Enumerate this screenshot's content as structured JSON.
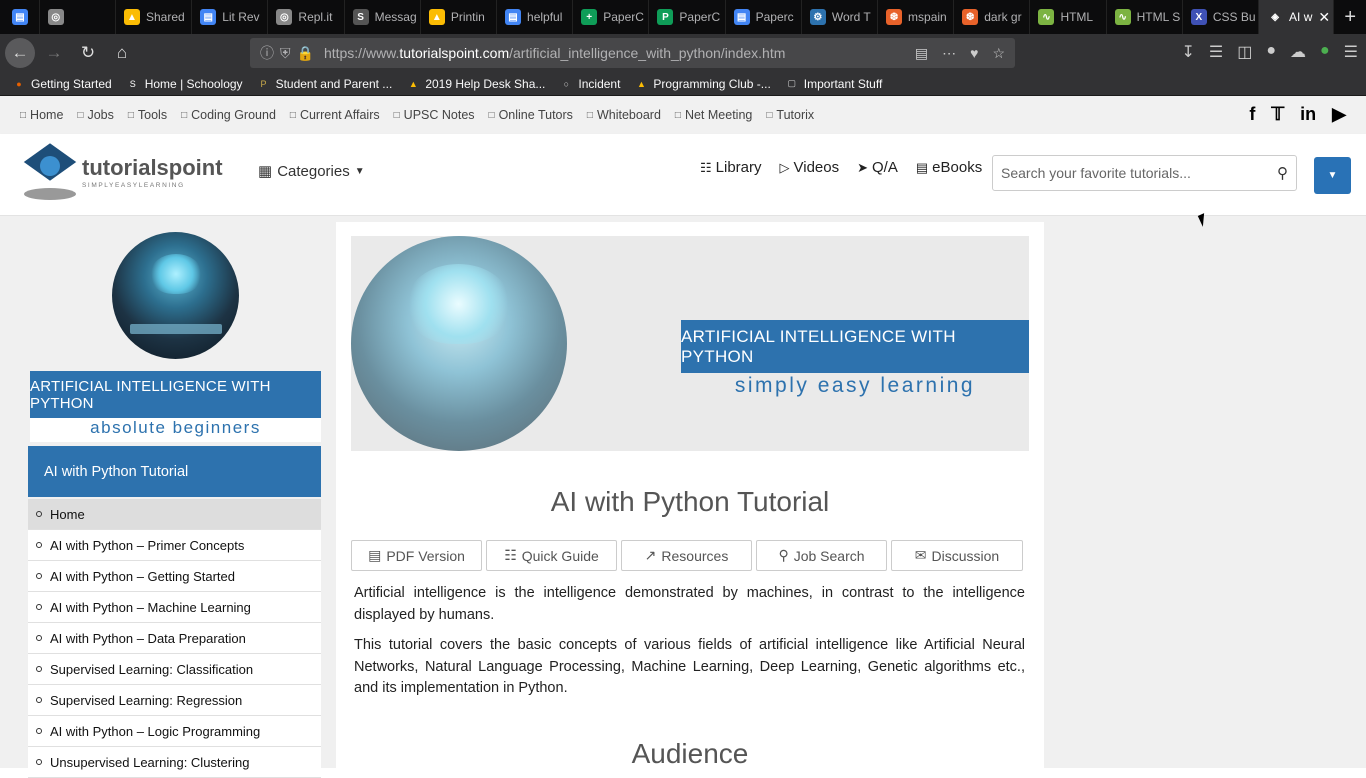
{
  "browser": {
    "tabs": [
      {
        "label": "",
        "color": "#4285f4",
        "icon": "docs-icon"
      },
      {
        "label": "",
        "color": "#888888",
        "icon": "spiral-icon"
      },
      {
        "label": "Shared",
        "color": "#fbbc04",
        "icon": "drive-icon"
      },
      {
        "label": "Lit Rev",
        "color": "#4285f4",
        "icon": "docs-icon"
      },
      {
        "label": "Repl.it",
        "color": "#888888",
        "icon": "replit-icon"
      },
      {
        "label": "Messag",
        "color": "#555555",
        "icon": "schoology-icon"
      },
      {
        "label": "Printin",
        "color": "#fbbc04",
        "icon": "drive-icon"
      },
      {
        "label": "helpful",
        "color": "#4285f4",
        "icon": "docs-icon"
      },
      {
        "label": "PaperC",
        "color": "#0f9d58",
        "icon": "sheets-icon"
      },
      {
        "label": "PaperC",
        "color": "#0f9d58",
        "icon": "paper-icon"
      },
      {
        "label": "Paperc",
        "color": "#4285f4",
        "icon": "docs-icon"
      },
      {
        "label": "Word T",
        "color": "#2d72ae",
        "icon": "word-icon"
      },
      {
        "label": "mspain",
        "color": "#e8622a",
        "icon": "mspaint-icon"
      },
      {
        "label": "dark gr",
        "color": "#e8622a",
        "icon": "dark-icon"
      },
      {
        "label": "HTML",
        "color": "#7cb342",
        "icon": "html-icon"
      },
      {
        "label": "HTML S",
        "color": "#7cb342",
        "icon": "html-icon"
      },
      {
        "label": "CSS Bu",
        "color": "#3f51b5",
        "icon": "css-icon"
      },
      {
        "label": "AI w",
        "color": "#ffffff",
        "icon": "tutorialspoint-icon",
        "active": true
      }
    ],
    "url_prefix": "https://www.",
    "url_domain": "tutorialspoint.com",
    "url_path": "/artificial_intelligence_with_python/index.htm",
    "bookmarks": [
      {
        "label": "Getting Started",
        "icon": "firefox-icon"
      },
      {
        "label": "Home | Schoology",
        "icon": "schoology-icon"
      },
      {
        "label": "Student and Parent ...",
        "icon": "portal-icon"
      },
      {
        "label": "2019 Help Desk Sha...",
        "icon": "drive-icon"
      },
      {
        "label": "Incident",
        "icon": "globe-icon"
      },
      {
        "label": "Programming Club -...",
        "icon": "drive-icon"
      },
      {
        "label": "Important Stuff",
        "icon": "folder-icon"
      }
    ]
  },
  "site": {
    "topnav": [
      {
        "label": "Home",
        "icon": "home-icon"
      },
      {
        "label": "Jobs",
        "icon": "briefcase-icon"
      },
      {
        "label": "Tools",
        "icon": "gears-icon"
      },
      {
        "label": "Coding Ground",
        "icon": "code-icon"
      },
      {
        "label": "Current Affairs",
        "icon": "current-affairs-icon"
      },
      {
        "label": "UPSC Notes",
        "icon": "upsc-icon"
      },
      {
        "label": "Online Tutors",
        "icon": "user-icon"
      },
      {
        "label": "Whiteboard",
        "icon": "whiteboard-icon"
      },
      {
        "label": "Net Meeting",
        "icon": "meeting-icon"
      },
      {
        "label": "Tutorix",
        "icon": "tutorix-icon"
      }
    ],
    "social": [
      "f",
      "t",
      "in",
      "yt"
    ],
    "logo_text": "tutorialspoint",
    "logo_tagline": "SIMPLYEASYLEARNING",
    "categories_label": "Categories",
    "header_links": [
      {
        "label": "Library",
        "icon": "library-icon"
      },
      {
        "label": "Videos",
        "icon": "video-icon"
      },
      {
        "label": "Q/A",
        "icon": "qa-icon"
      },
      {
        "label": "eBooks",
        "icon": "ebook-icon"
      }
    ],
    "search_placeholder": "Search your favorite tutorials...",
    "accent": "#2d72ae"
  },
  "sidebar": {
    "banner_title": "ARTIFICIAL INTELLIGENCE WITH PYTHON",
    "banner_sub": "absolute beginners",
    "title": "AI with Python Tutorial",
    "items": [
      {
        "label": "Home",
        "active": true
      },
      {
        "label": "AI with Python – Primer Concepts"
      },
      {
        "label": "AI with Python – Getting Started"
      },
      {
        "label": "AI with Python – Machine Learning"
      },
      {
        "label": "AI with Python – Data Preparation"
      },
      {
        "label": "Supervised Learning: Classification"
      },
      {
        "label": "Supervised Learning: Regression"
      },
      {
        "label": "AI with Python – Logic Programming"
      },
      {
        "label": "Unsupervised Learning: Clustering"
      }
    ]
  },
  "main": {
    "banner_title": "ARTIFICIAL INTELLIGENCE WITH PYTHON",
    "banner_sub": "simply easy learning",
    "title": "AI with Python Tutorial",
    "buttons": [
      {
        "label": "PDF Version",
        "icon": "pdf-icon"
      },
      {
        "label": "Quick Guide",
        "icon": "book-icon"
      },
      {
        "label": "Resources",
        "icon": "external-link-icon"
      },
      {
        "label": "Job Search",
        "icon": "search-icon"
      },
      {
        "label": "Discussion",
        "icon": "comments-icon"
      }
    ],
    "para1": "Artificial intelligence is the intelligence demonstrated by machines, in contrast to the intelligence displayed by humans.",
    "para2": "This tutorial covers the basic concepts of various fields of artificial intelligence like Artificial Neural Networks, Natural Language Processing, Machine Learning, Deep Learning, Genetic algorithms etc., and its implementation in Python.",
    "section_heading": "Audience"
  }
}
